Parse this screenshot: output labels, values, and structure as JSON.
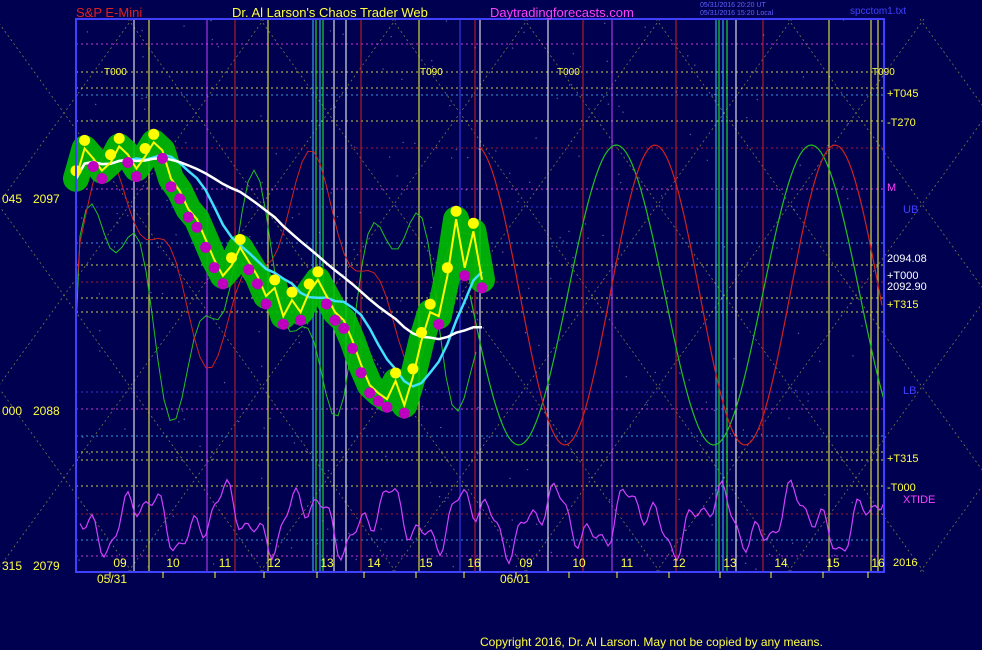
{
  "header": {
    "symbol": "S&P E-Mini",
    "author": "Dr. Al Larson's Chaos Trader Web",
    "site": "Daytradingforecasts.com",
    "stamp_line1": "05/31/2016 20:20 UT",
    "stamp_line2": "05/31/2016 15:20 Local",
    "file": "spcctom1.txt"
  },
  "copyright": "Copyright 2016, Dr. Al Larson. May not be copied by any means.",
  "colors": {
    "background": "#000050",
    "plot_border": "#4040ff",
    "price": "#ffff00",
    "avg_fast": "#40e0ff",
    "avg_slow": "#ffffff",
    "band": "#00c000",
    "dot_up": "#ffff00",
    "dot_down": "#c000c0",
    "red_cycle": "#d02020",
    "green_cycle": "#20c020",
    "xtide": "#d040ff"
  },
  "top_markers": [
    "T000",
    "T090",
    "T000",
    "T090"
  ],
  "right_labels": [
    "+T045",
    "-T270",
    "M",
    "UB",
    "2094.08",
    "+T000",
    "2092.90",
    "+T315",
    "LB",
    "+T315",
    "-T000",
    "XTIDE",
    "2016"
  ],
  "left_labels": [
    "045",
    "000",
    "315"
  ],
  "chart_data": {
    "type": "line",
    "title": "S&P E-Mini",
    "xlabel": "",
    "ylabel": "",
    "y_ticks": [
      2097,
      2088,
      2079
    ],
    "ylim": [
      2079,
      2101
    ],
    "x_hour_ticks": [
      "09",
      "10",
      "11",
      "12",
      "13",
      "14",
      "15",
      "16",
      "09",
      "10",
      "11",
      "12",
      "13",
      "14",
      "15",
      "16"
    ],
    "x_dates": [
      "05/31",
      "06/01"
    ],
    "last_price": 2092.9,
    "series": [
      {
        "values": [
          2098.2,
          2099.7,
          2099.2,
          2098.6,
          2099.0,
          2099.8,
          2099.4,
          2098.7,
          2099.3,
          2100.0,
          2099.6,
          2098.2,
          2097.6,
          2096.7,
          2096.2,
          2095.2,
          2094.2,
          2093.4,
          2093.9,
          2094.8,
          2094.1,
          2093.4,
          2092.4,
          2092.8,
          2091.4,
          2092.2,
          2091.6,
          2092.6,
          2093.2,
          2092.4,
          2091.6,
          2091.2,
          2090.2,
          2089.0,
          2088.0,
          2087.6,
          2087.3,
          2088.2,
          2087.0,
          2088.4,
          2090.2,
          2091.6,
          2091.4,
          2093.4,
          2096.2,
          2093.8,
          2095.6,
          2093.2
        ]
      }
    ]
  }
}
